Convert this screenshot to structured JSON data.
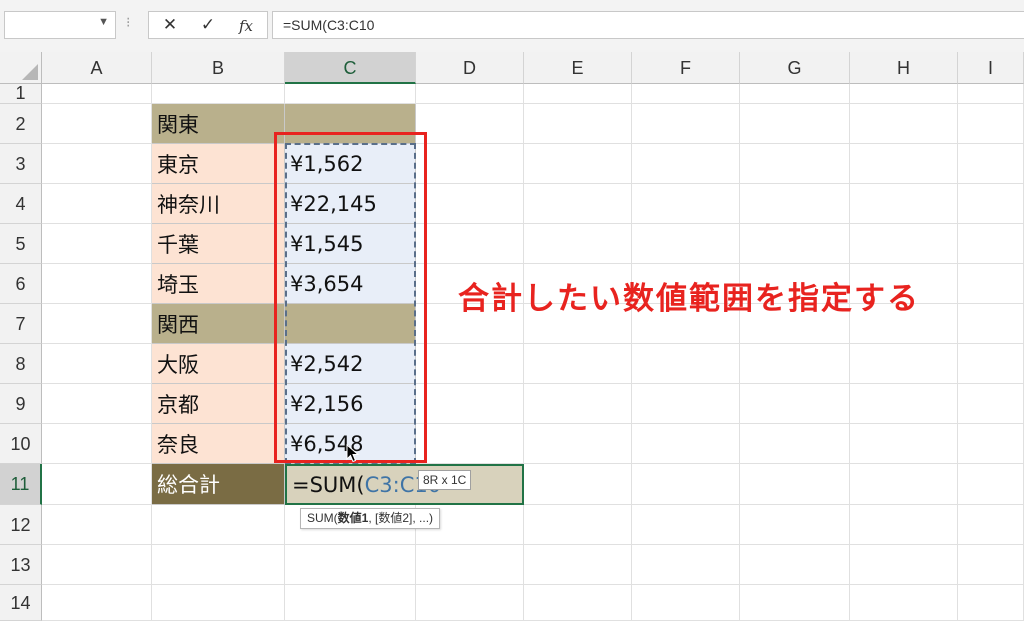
{
  "formula_bar": {
    "name_box": "",
    "cancel_glyph": "✕",
    "enter_glyph": "✓",
    "fx_label": "fx",
    "formula": "=SUM(C3:C10"
  },
  "columns": [
    "A",
    "B",
    "C",
    "D",
    "E",
    "F",
    "G",
    "H",
    "I"
  ],
  "rows": [
    "1",
    "2",
    "3",
    "4",
    "5",
    "6",
    "7",
    "8",
    "9",
    "10",
    "11",
    "12",
    "13",
    "14"
  ],
  "selected_column": "C",
  "selected_row": "11",
  "table": {
    "r2": {
      "label": "関東",
      "value": ""
    },
    "r3": {
      "label": "東京",
      "value": "¥1,562"
    },
    "r4": {
      "label": "神奈川",
      "value": "¥22,145"
    },
    "r5": {
      "label": "千葉",
      "value": "¥1,545"
    },
    "r6": {
      "label": "埼玉",
      "value": "¥3,654"
    },
    "r7": {
      "label": "関西",
      "value": ""
    },
    "r8": {
      "label": "大阪",
      "value": "¥2,542"
    },
    "r9": {
      "label": "京都",
      "value": "¥2,156"
    },
    "r10": {
      "label": "奈良",
      "value": "¥6,548"
    },
    "r11": {
      "label": "総合計",
      "formula_prefix": "=SUM(",
      "formula_ref": "C3:C10"
    }
  },
  "range_badge": "8R x 1C",
  "tooltip": {
    "prefix": "SUM(",
    "bold": "数値1",
    "suffix": ", [数値2], ...)"
  },
  "annotation": "合計したい数値範囲を指定する",
  "colors": {
    "region_fill": "#b9b08c",
    "prefecture_fill": "#fde3d3",
    "value_fill": "#e8eef8",
    "total_label_fill": "#7a6c44",
    "total_value_fill": "#d8d2bc",
    "highlight": "#e8231f",
    "reference_text": "#3f74a6"
  },
  "icons": {
    "cancel": "close-icon",
    "enter": "checkmark-icon",
    "function": "fx-icon",
    "pointer": "mouse-cursor-icon"
  }
}
